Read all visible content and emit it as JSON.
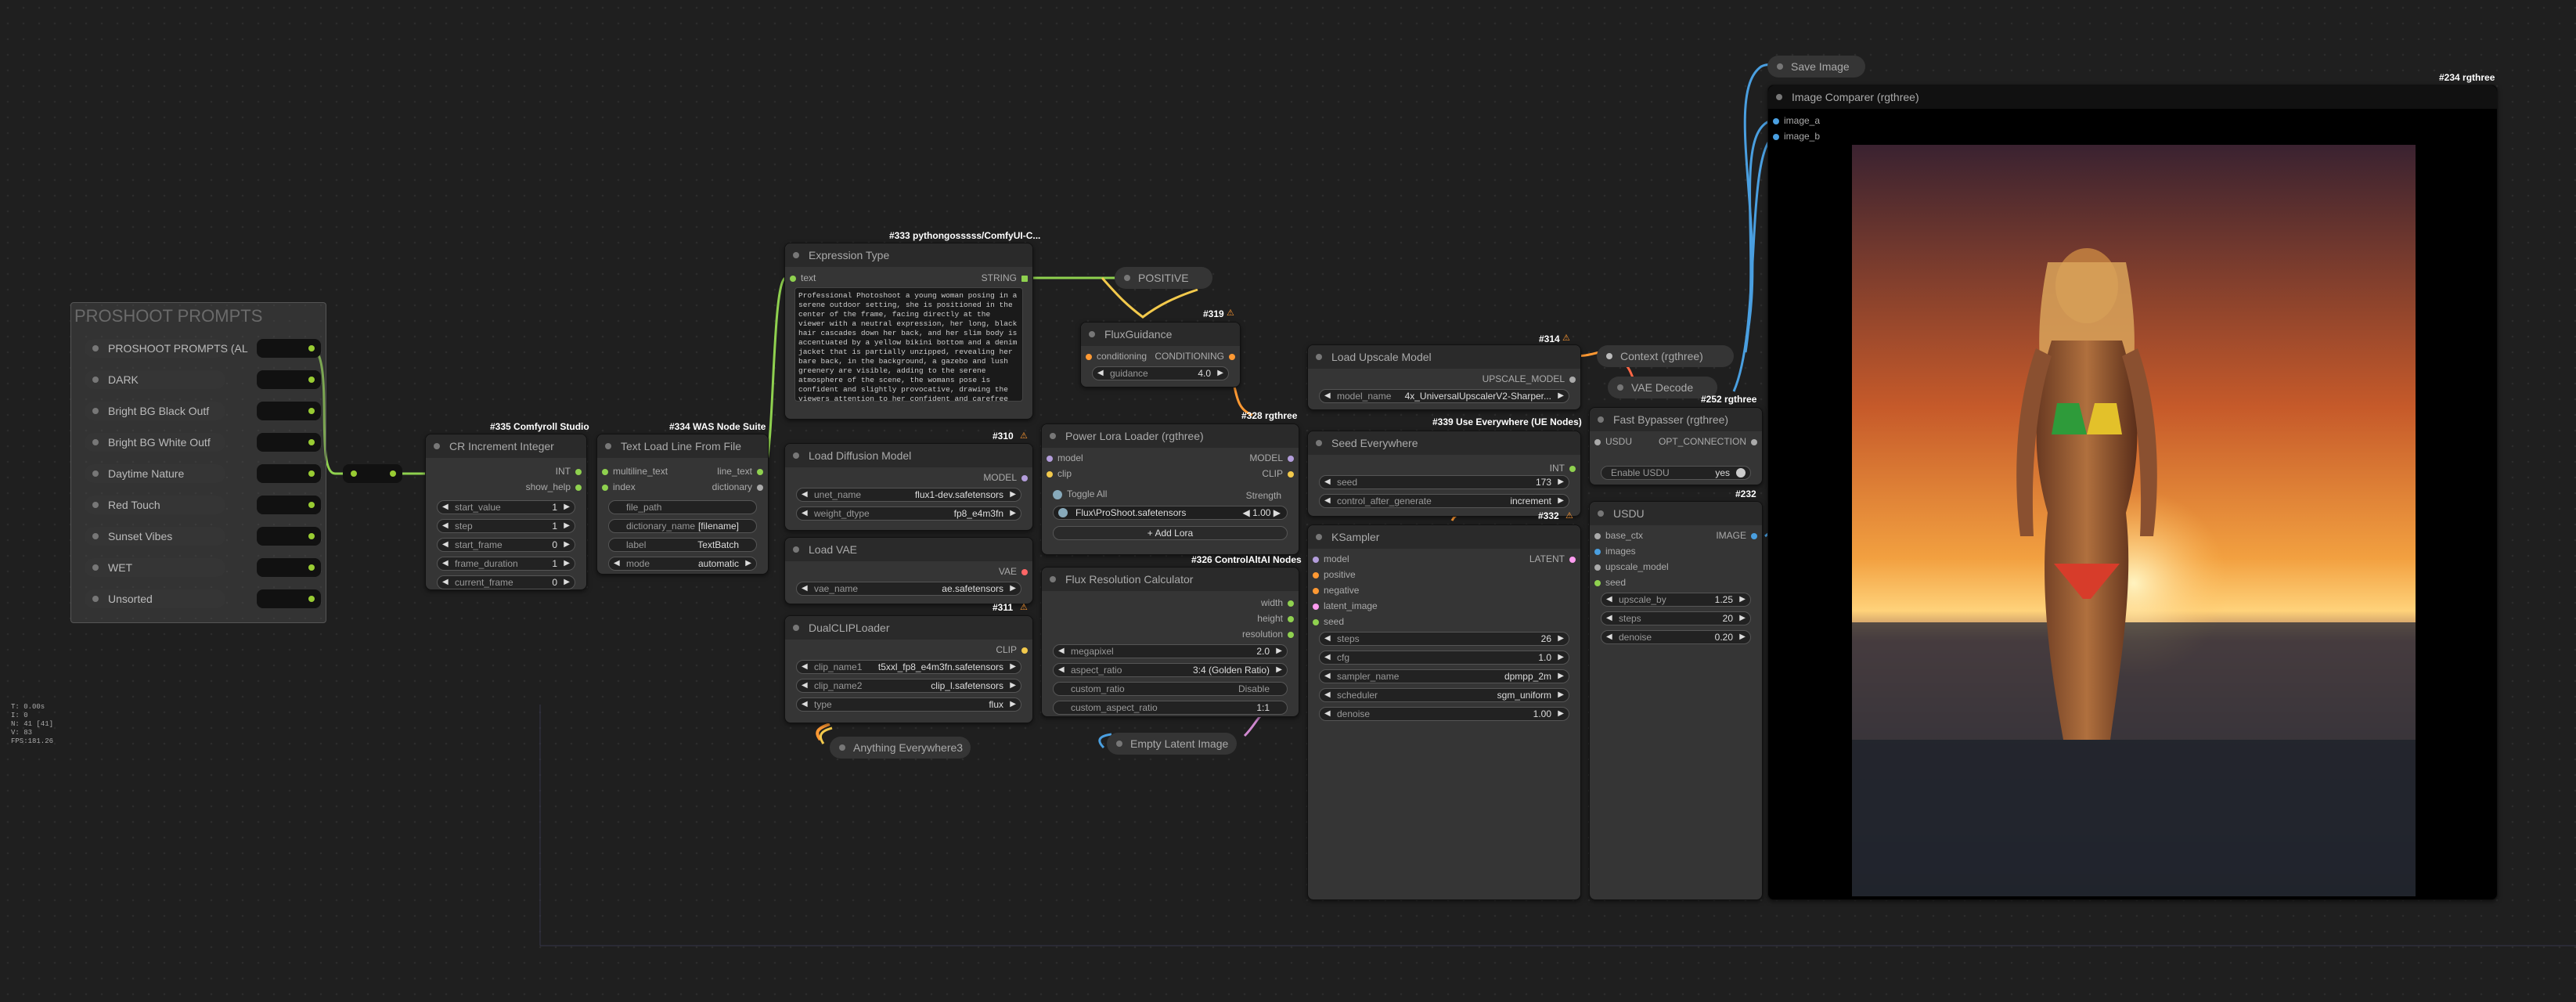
{
  "stats": [
    "T: 0.00s",
    "I: 0",
    "N: 41 [41]",
    "V: 83",
    "FPS:181.26"
  ],
  "group": {
    "title": "PROSHOOT PROMPTS"
  },
  "prompts": [
    {
      "label": "PROSHOOT PROMPTS (AL"
    },
    {
      "label": "DARK"
    },
    {
      "label": "Bright BG Black Outf"
    },
    {
      "label": "Bright BG White Outf"
    },
    {
      "label": "Daytime Nature"
    },
    {
      "label": "Red Touch"
    },
    {
      "label": "Sunset Vibes"
    },
    {
      "label": "WET"
    },
    {
      "label": "Unsorted"
    }
  ],
  "cr": {
    "badge": "#335 Comfyroll Studio",
    "title": "CR Increment Integer",
    "out1": "INT",
    "out2": "show_help",
    "w": [
      {
        "l": "start_value",
        "v": "1"
      },
      {
        "l": "step",
        "v": "1"
      },
      {
        "l": "start_frame",
        "v": "0"
      },
      {
        "l": "frame_duration",
        "v": "1"
      },
      {
        "l": "current_frame",
        "v": "0"
      }
    ]
  },
  "was": {
    "badge": "#334 WAS Node Suite",
    "title": "Text Load Line From File",
    "in1": "multiline_text",
    "in2": "index",
    "out1": "line_text",
    "out2": "dictionary",
    "w": [
      {
        "l": "file_path",
        "v": ""
      },
      {
        "l": "dictionary_name",
        "v": "[filename]"
      },
      {
        "l": "label",
        "v": "TextBatch"
      },
      {
        "l": "mode",
        "v": "automatic"
      }
    ]
  },
  "expr": {
    "badge": "#333 pythongosssss/ComfyUI-C...",
    "title": "Expression Type",
    "in": "text",
    "out": "STRING",
    "text": "Professional Photoshoot a young woman posing in a serene outdoor setting, she is positioned in the center of the frame, facing directly at the viewer with a neutral expression, her long, black hair cascades down her back, and her slim body is accentuated by a yellow bikini bottom and a denim jacket that is partially unzipped, revealing her bare back, in the background, a gazebo and lush greenery are visible, adding to the serene atmosphere of the scene, the womans pose is confident and slightly provocative, drawing the viewers attention to her confident and carefree demeanor"
  },
  "diffusion": {
    "badge": "#310",
    "title": "Load Diffusion Model",
    "out": "MODEL",
    "w": [
      {
        "l": "unet_name",
        "v": "flux1-dev.safetensors"
      },
      {
        "l": "weight_dtype",
        "v": "fp8_e4m3fn"
      }
    ]
  },
  "vae": {
    "title": "Load VAE",
    "out": "VAE",
    "w": [
      {
        "l": "vae_name",
        "v": "ae.safetensors"
      }
    ]
  },
  "dualclip": {
    "badge": "#311",
    "title": "DualCLIPLoader",
    "out": "CLIP",
    "w": [
      {
        "l": "clip_name1",
        "v": "t5xxl_fp8_e4m3fn.safetensors"
      },
      {
        "l": "clip_name2",
        "v": "clip_l.safetensors"
      },
      {
        "l": "type",
        "v": "flux"
      }
    ]
  },
  "anything": {
    "title": "Anything Everywhere3"
  },
  "positive": {
    "title": "POSITIVE"
  },
  "fluxguid": {
    "badge": "#319",
    "title": "FluxGuidance",
    "in": "conditioning",
    "out": "CONDITIONING",
    "w": [
      {
        "l": "guidance",
        "v": "4.0"
      }
    ]
  },
  "lora": {
    "badge": "#328 rgthree",
    "title": "Power Lora Loader (rgthree)",
    "in1": "model",
    "in2": "clip",
    "out1": "MODEL",
    "out2": "CLIP",
    "toggle": "Toggle All",
    "strength": "Strength",
    "lora_name": "Flux\\ProShoot.safetensors",
    "lora_val": "1.00",
    "add": "Add Lora"
  },
  "fluxres": {
    "badge": "#326 ControlAltAI Nodes",
    "title": "Flux Resolution Calculator",
    "o1": "width",
    "o2": "height",
    "o3": "resolution",
    "w": [
      {
        "l": "megapixel",
        "v": "2.0"
      },
      {
        "l": "aspect_ratio",
        "v": "3:4 (Golden Ratio)"
      },
      {
        "l": "custom_ratio",
        "v": "Disable"
      },
      {
        "l": "custom_aspect_ratio",
        "v": "1:1"
      }
    ]
  },
  "emptylatent": {
    "title": "Empty Latent Image"
  },
  "upscale": {
    "badge": "#339 Use Everywhere (UE Nodes)",
    "title": "Load Upscale Model",
    "out": "UPSCALE_MODEL",
    "w": [
      {
        "l": "model_name",
        "v": "4x_UniversalUpscalerV2-Sharper..."
      }
    ]
  },
  "seed": {
    "badge": "#332",
    "title": "Seed Everywhere",
    "out": "INT",
    "w": [
      {
        "l": "seed",
        "v": "173"
      },
      {
        "l": "control_after_generate",
        "v": "increment"
      }
    ]
  },
  "ksampler": {
    "title": "KSampler",
    "ins": [
      "model",
      "positive",
      "negative",
      "latent_image",
      "seed"
    ],
    "out": "LATENT",
    "w": [
      {
        "l": "steps",
        "v": "26"
      },
      {
        "l": "cfg",
        "v": "1.0"
      },
      {
        "l": "sampler_name",
        "v": "dpmpp_2m"
      },
      {
        "l": "scheduler",
        "v": "sgm_uniform"
      },
      {
        "l": "denoise",
        "v": "1.00"
      }
    ]
  },
  "context": {
    "badge": "#314",
    "title": "Context (rgthree)"
  },
  "vaedecode": {
    "badge": "#252 rgthree",
    "title": "VAE Decode"
  },
  "bypasser": {
    "title": "Fast Bypasser (rgthree)",
    "in": "USDU",
    "out": "OPT_CONNECTION",
    "w_label": "Enable USDU",
    "w_value": "yes"
  },
  "usdu": {
    "badge": "#232",
    "title": "USDU",
    "ins": [
      "base_ctx",
      "images",
      "upscale_model",
      "seed"
    ],
    "out": "IMAGE",
    "w": [
      {
        "l": "upscale_by",
        "v": "1.25"
      },
      {
        "l": "steps",
        "v": "20"
      },
      {
        "l": "denoise",
        "v": "0.20"
      }
    ]
  },
  "save": {
    "title": "Save Image"
  },
  "comparer": {
    "badge": "#234 rgthree",
    "title": "Image Comparer (rgthree)",
    "in1": "image_a",
    "in2": "image_b"
  },
  "colors": {
    "green": "#8fd14f",
    "orange": "#ff9933",
    "blue": "#4a9fe0",
    "pink": "#d088d0",
    "yellow": "#f2c94c",
    "purple": "#a87cdc"
  }
}
